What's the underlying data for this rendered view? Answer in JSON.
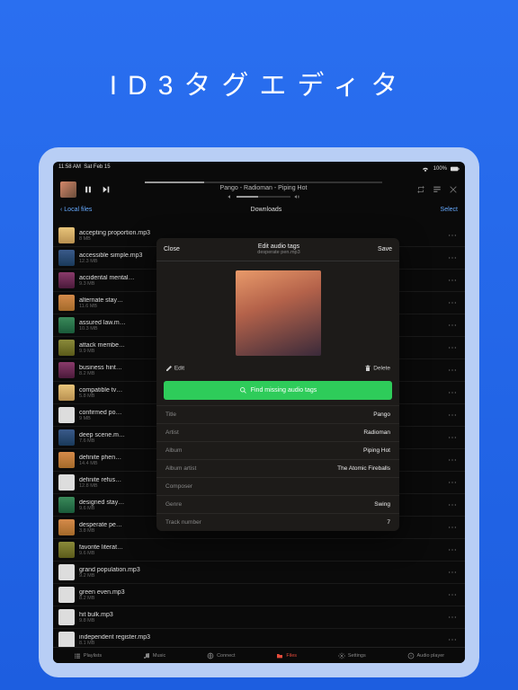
{
  "hero_title": "ID3タグエディタ",
  "status": {
    "time": "11:58 AM",
    "date": "Sat Feb 15",
    "battery": "100%"
  },
  "player": {
    "track": "Pango - Radioman - Piping Hot"
  },
  "toolbar": {
    "back": "Local files",
    "title": "Downloads",
    "select": "Select"
  },
  "files": [
    {
      "name": "accepting proportion.mp3",
      "size": "8 MB",
      "t": "t1"
    },
    {
      "name": "accessible simple.mp3",
      "size": "12.3 MB",
      "t": "t2"
    },
    {
      "name": "accidental mental…",
      "size": "9.3 MB",
      "t": "t3"
    },
    {
      "name": "alternate stay…",
      "size": "11.6 MB",
      "t": "t4"
    },
    {
      "name": "assured law.m…",
      "size": "10.3 MB",
      "t": "t5"
    },
    {
      "name": "attack membe…",
      "size": "9.9 MB",
      "t": "t6"
    },
    {
      "name": "business hint…",
      "size": "8.2 MB",
      "t": "t3"
    },
    {
      "name": "compatible tv…",
      "size": "5.8 MB",
      "t": "t1"
    },
    {
      "name": "confirmed po…",
      "size": "9 MB",
      "t": "t7"
    },
    {
      "name": "deep scene.m…",
      "size": "7.6 MB",
      "t": "t2"
    },
    {
      "name": "definite phen…",
      "size": "14.4 MB",
      "t": "t4"
    },
    {
      "name": "definite refus…",
      "size": "12.8 MB",
      "t": "t7"
    },
    {
      "name": "designed stay…",
      "size": "9.6 MB",
      "t": "t5"
    },
    {
      "name": "desperate pe…",
      "size": "3.8 MB",
      "t": "t4"
    },
    {
      "name": "favorite literat…",
      "size": "9.6 MB",
      "t": "t6"
    },
    {
      "name": "grand population.mp3",
      "size": "9.2 MB",
      "t": "t7"
    },
    {
      "name": "green even.mp3",
      "size": "8.2 MB",
      "t": "t7"
    },
    {
      "name": "hit bulk.mp3",
      "size": "9.8 MB",
      "t": "t7"
    },
    {
      "name": "independent register.mp3",
      "size": "8.1 MB",
      "t": "t7"
    }
  ],
  "modal": {
    "close": "Close",
    "title": "Edit audio tags",
    "sub": "desperate pen.mp3",
    "save": "Save",
    "edit": "Edit",
    "delete": "Delete",
    "find": "Find missing audio tags",
    "fields": [
      {
        "lbl": "Title",
        "val": "Pango"
      },
      {
        "lbl": "Artist",
        "val": "Radioman"
      },
      {
        "lbl": "Album",
        "val": "Piping Hot"
      },
      {
        "lbl": "Album artist",
        "val": "The Atomic Fireballs"
      },
      {
        "lbl": "Composer",
        "val": ""
      },
      {
        "lbl": "Genre",
        "val": "Swing"
      },
      {
        "lbl": "Track number",
        "val": "7"
      }
    ]
  },
  "tabs": [
    {
      "label": "Playlists",
      "icon": "list"
    },
    {
      "label": "Music",
      "icon": "music"
    },
    {
      "label": "Connect",
      "icon": "globe"
    },
    {
      "label": "Files",
      "icon": "folder",
      "active": true
    },
    {
      "label": "Settings",
      "icon": "gear"
    },
    {
      "label": "Audio player",
      "icon": "disc"
    }
  ]
}
